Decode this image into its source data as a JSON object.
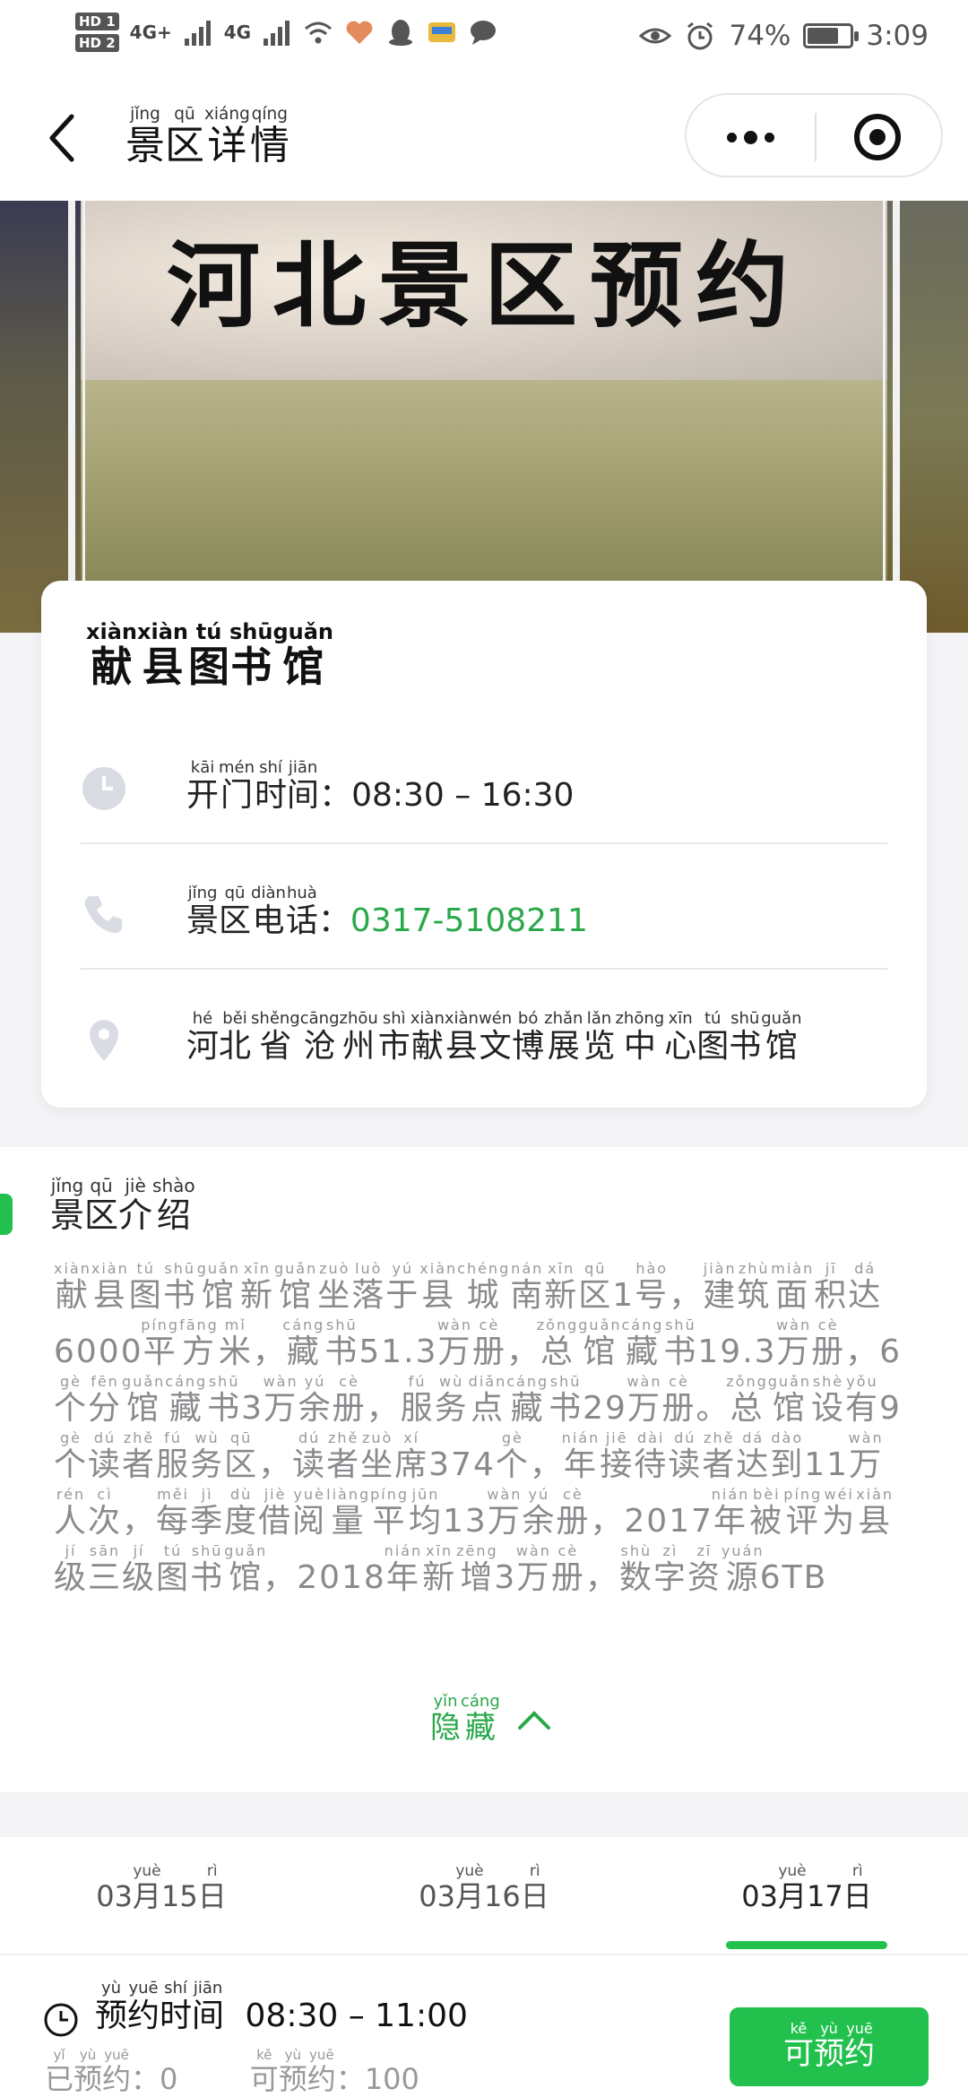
{
  "status_bar": {
    "hd1": "HD 1",
    "hd2": "HD 2",
    "signal1": "4G+",
    "signal2": "4G",
    "battery_percent": "74%",
    "battery_level": 0.74,
    "time": "3:09"
  },
  "nav": {
    "title_chars": [
      {
        "c": "景",
        "p": "jǐng"
      },
      {
        "c": "区",
        "p": "qū"
      },
      {
        "c": "详",
        "p": "xiáng"
      },
      {
        "c": "情",
        "p": "qíng"
      }
    ]
  },
  "banner": {
    "title": "河北景区预约"
  },
  "place": {
    "name_chars": [
      {
        "c": "献",
        "p": "xiàn"
      },
      {
        "c": "县",
        "p": "xiàn"
      },
      {
        "c": "图",
        "p": "tú"
      },
      {
        "c": "书",
        "p": "shū"
      },
      {
        "c": "馆",
        "p": "guǎn"
      }
    ],
    "open_label_chars": [
      {
        "c": "开",
        "p": "kāi"
      },
      {
        "c": "门",
        "p": "mén"
      },
      {
        "c": "时",
        "p": "shí"
      },
      {
        "c": "间",
        "p": "jiān"
      }
    ],
    "open_hours": "：08:30 – 16:30",
    "phone_label_chars": [
      {
        "c": "景",
        "p": "jǐng"
      },
      {
        "c": "区",
        "p": "qū"
      },
      {
        "c": "电",
        "p": "diàn"
      },
      {
        "c": "话",
        "p": "huà"
      }
    ],
    "phone_colon": "：",
    "phone": "0317-5108211",
    "address_chars": [
      {
        "c": "河",
        "p": "hé"
      },
      {
        "c": "北",
        "p": "běi"
      },
      {
        "c": "省",
        "p": "shěng"
      },
      {
        "c": "沧",
        "p": "cāng"
      },
      {
        "c": "州",
        "p": "zhōu"
      },
      {
        "c": "市",
        "p": "shì"
      },
      {
        "c": "献",
        "p": "xiàn"
      },
      {
        "c": "县",
        "p": "xiàn"
      },
      {
        "c": "文",
        "p": "wén"
      },
      {
        "c": "博",
        "p": "bó"
      },
      {
        "c": "展",
        "p": "zhǎn"
      },
      {
        "c": "览",
        "p": "lǎn"
      },
      {
        "c": "中",
        "p": "zhōng"
      },
      {
        "c": "心",
        "p": "xīn"
      },
      {
        "c": "图",
        "p": "tú"
      },
      {
        "c": "书",
        "p": "shū"
      },
      {
        "c": "馆",
        "p": "guǎn"
      }
    ]
  },
  "intro": {
    "title_chars": [
      {
        "c": "景",
        "p": "jǐng"
      },
      {
        "c": "区",
        "p": "qū"
      },
      {
        "c": "介",
        "p": "jiè"
      },
      {
        "c": "绍",
        "p": "shào"
      }
    ],
    "text": [
      {
        "c": "献",
        "p": "xiàn"
      },
      {
        "c": "县",
        "p": "xiàn"
      },
      {
        "c": "图",
        "p": "tú"
      },
      {
        "c": "书",
        "p": "shū"
      },
      {
        "c": "馆",
        "p": "guǎn"
      },
      {
        "c": "新",
        "p": "xīn"
      },
      {
        "c": "馆",
        "p": "guǎn"
      },
      {
        "c": "坐",
        "p": "zuò"
      },
      {
        "c": "落",
        "p": "luò"
      },
      {
        "c": "于",
        "p": "yú"
      },
      {
        "c": "县",
        "p": "xiàn"
      },
      {
        "c": "城",
        "p": "chéng"
      },
      {
        "c": "南",
        "p": "nán"
      },
      {
        "c": "新",
        "p": "xīn"
      },
      {
        "c": "区",
        "p": "qū"
      },
      {
        "c": "1",
        "p": ""
      },
      {
        "c": "号",
        "p": "hào"
      },
      {
        "c": "，",
        "p": ""
      },
      {
        "c": "建",
        "p": "jiàn"
      },
      {
        "c": "筑",
        "p": "zhù"
      },
      {
        "c": "面",
        "p": "miàn"
      },
      {
        "c": "积",
        "p": "jī"
      },
      {
        "c": "达",
        "p": "dá"
      },
      {
        "c": "6000",
        "p": ""
      },
      {
        "c": "平",
        "p": "píng"
      },
      {
        "c": "方",
        "p": "fāng"
      },
      {
        "c": "米",
        "p": "mǐ"
      },
      {
        "c": "，",
        "p": ""
      },
      {
        "c": "藏",
        "p": "cáng"
      },
      {
        "c": "书",
        "p": "shū"
      },
      {
        "c": "51.3",
        "p": ""
      },
      {
        "c": "万",
        "p": "wàn"
      },
      {
        "c": "册",
        "p": "cè"
      },
      {
        "c": "，",
        "p": ""
      },
      {
        "c": "总",
        "p": "zǒng"
      },
      {
        "c": "馆",
        "p": "guǎn"
      },
      {
        "c": "藏",
        "p": "cáng"
      },
      {
        "c": "书",
        "p": "shū"
      },
      {
        "c": "19.3",
        "p": ""
      },
      {
        "c": "万",
        "p": "wàn"
      },
      {
        "c": "册",
        "p": "cè"
      },
      {
        "c": "，",
        "p": ""
      },
      {
        "c": "6",
        "p": ""
      },
      {
        "c": "个",
        "p": "gè"
      },
      {
        "c": "分",
        "p": "fēn"
      },
      {
        "c": "馆",
        "p": "guǎn"
      },
      {
        "c": "藏",
        "p": "cáng"
      },
      {
        "c": "书",
        "p": "shū"
      },
      {
        "c": "3",
        "p": ""
      },
      {
        "c": "万",
        "p": "wàn"
      },
      {
        "c": "余",
        "p": "yú"
      },
      {
        "c": "册",
        "p": "cè"
      },
      {
        "c": "，",
        "p": ""
      },
      {
        "c": "服",
        "p": "fú"
      },
      {
        "c": "务",
        "p": "wù"
      },
      {
        "c": "点",
        "p": "diǎn"
      },
      {
        "c": "藏",
        "p": "cáng"
      },
      {
        "c": "书",
        "p": "shū"
      },
      {
        "c": "29",
        "p": ""
      },
      {
        "c": "万",
        "p": "wàn"
      },
      {
        "c": "册",
        "p": "cè"
      },
      {
        "c": "。",
        "p": ""
      },
      {
        "c": "总",
        "p": "zǒng"
      },
      {
        "c": "馆",
        "p": "guǎn"
      },
      {
        "c": "设",
        "p": "shè"
      },
      {
        "c": "有",
        "p": "yǒu"
      },
      {
        "c": "9",
        "p": ""
      },
      {
        "c": "个",
        "p": "gè"
      },
      {
        "c": "读",
        "p": "dú"
      },
      {
        "c": "者",
        "p": "zhě"
      },
      {
        "c": "服",
        "p": "fú"
      },
      {
        "c": "务",
        "p": "wù"
      },
      {
        "c": "区",
        "p": "qū"
      },
      {
        "c": "，",
        "p": ""
      },
      {
        "c": "读",
        "p": "dú"
      },
      {
        "c": "者",
        "p": "zhě"
      },
      {
        "c": "坐",
        "p": "zuò"
      },
      {
        "c": "席",
        "p": "xí"
      },
      {
        "c": "374",
        "p": ""
      },
      {
        "c": "个",
        "p": "gè"
      },
      {
        "c": "，",
        "p": ""
      },
      {
        "c": "年",
        "p": "nián"
      },
      {
        "c": "接",
        "p": "jiē"
      },
      {
        "c": "待",
        "p": "dài"
      },
      {
        "c": "读",
        "p": "dú"
      },
      {
        "c": "者",
        "p": "zhě"
      },
      {
        "c": "达",
        "p": "dá"
      },
      {
        "c": "到",
        "p": "dào"
      },
      {
        "c": "11",
        "p": ""
      },
      {
        "c": "万",
        "p": "wàn"
      },
      {
        "c": "人",
        "p": "rén"
      },
      {
        "c": "次",
        "p": "cì"
      },
      {
        "c": "，",
        "p": ""
      },
      {
        "c": "每",
        "p": "měi"
      },
      {
        "c": "季",
        "p": "jì"
      },
      {
        "c": "度",
        "p": "dù"
      },
      {
        "c": "借",
        "p": "jiè"
      },
      {
        "c": "阅",
        "p": "yuè"
      },
      {
        "c": "量",
        "p": "liàng"
      },
      {
        "c": "平",
        "p": "píng"
      },
      {
        "c": "均",
        "p": "jūn"
      },
      {
        "c": "13",
        "p": ""
      },
      {
        "c": "万",
        "p": "wàn"
      },
      {
        "c": "余",
        "p": "yú"
      },
      {
        "c": "册",
        "p": "cè"
      },
      {
        "c": "，",
        "p": ""
      },
      {
        "c": "2017",
        "p": ""
      },
      {
        "c": "年",
        "p": "nián"
      },
      {
        "c": "被",
        "p": "bèi"
      },
      {
        "c": "评",
        "p": "píng"
      },
      {
        "c": "为",
        "p": "wéi"
      },
      {
        "c": "县",
        "p": "xiàn"
      },
      {
        "c": "级",
        "p": "jí"
      },
      {
        "c": "三",
        "p": "sān"
      },
      {
        "c": "级",
        "p": "jí"
      },
      {
        "c": "图",
        "p": "tú"
      },
      {
        "c": "书",
        "p": "shū"
      },
      {
        "c": "馆",
        "p": "guǎn"
      },
      {
        "c": "，",
        "p": ""
      },
      {
        "c": "2018",
        "p": ""
      },
      {
        "c": "年",
        "p": "nián"
      },
      {
        "c": "新",
        "p": "xīn"
      },
      {
        "c": "增",
        "p": "zēng"
      },
      {
        "c": "3",
        "p": ""
      },
      {
        "c": "万",
        "p": "wàn"
      },
      {
        "c": "册",
        "p": "cè"
      },
      {
        "c": "，",
        "p": ""
      },
      {
        "c": "数",
        "p": "shù"
      },
      {
        "c": "字",
        "p": "zì"
      },
      {
        "c": "资",
        "p": "zī"
      },
      {
        "c": "源",
        "p": "yuán"
      },
      {
        "c": "6TB",
        "p": ""
      }
    ],
    "toggle_chars": [
      {
        "c": "隐",
        "p": "yǐn"
      },
      {
        "c": "藏",
        "p": "cáng"
      }
    ]
  },
  "dates": [
    {
      "parts": [
        {
          "c": "03",
          "p": ""
        },
        {
          "c": "月",
          "p": "yuè"
        },
        {
          "c": "15",
          "p": ""
        },
        {
          "c": "日",
          "p": "rì"
        }
      ],
      "active": false
    },
    {
      "parts": [
        {
          "c": "03",
          "p": ""
        },
        {
          "c": "月",
          "p": "yuè"
        },
        {
          "c": "16",
          "p": ""
        },
        {
          "c": "日",
          "p": "rì"
        }
      ],
      "active": false
    },
    {
      "parts": [
        {
          "c": "03",
          "p": ""
        },
        {
          "c": "月",
          "p": "yuè"
        },
        {
          "c": "17",
          "p": ""
        },
        {
          "c": "日",
          "p": "rì"
        }
      ],
      "active": true
    }
  ],
  "booking": {
    "label_chars": [
      {
        "c": "预",
        "p": "yù"
      },
      {
        "c": "约",
        "p": "yuē"
      },
      {
        "c": "时",
        "p": "shí"
      },
      {
        "c": "间",
        "p": "jiān"
      }
    ],
    "time_range": "08:30 – 11:00",
    "booked_chars": [
      {
        "c": "已",
        "p": "yǐ"
      },
      {
        "c": "预",
        "p": "yù"
      },
      {
        "c": "约",
        "p": "yuē"
      }
    ],
    "booked_value": "：0",
    "available_chars": [
      {
        "c": "可",
        "p": "kě"
      },
      {
        "c": "预",
        "p": "yù"
      },
      {
        "c": "约",
        "p": "yuē"
      }
    ],
    "available_value": "：100",
    "button_chars": [
      {
        "c": "可",
        "p": "kě"
      },
      {
        "c": "预",
        "p": "yù"
      },
      {
        "c": "约",
        "p": "yuē"
      }
    ]
  },
  "colors": {
    "accent_green": "#22c14e",
    "phone_green": "#2aa84a"
  }
}
